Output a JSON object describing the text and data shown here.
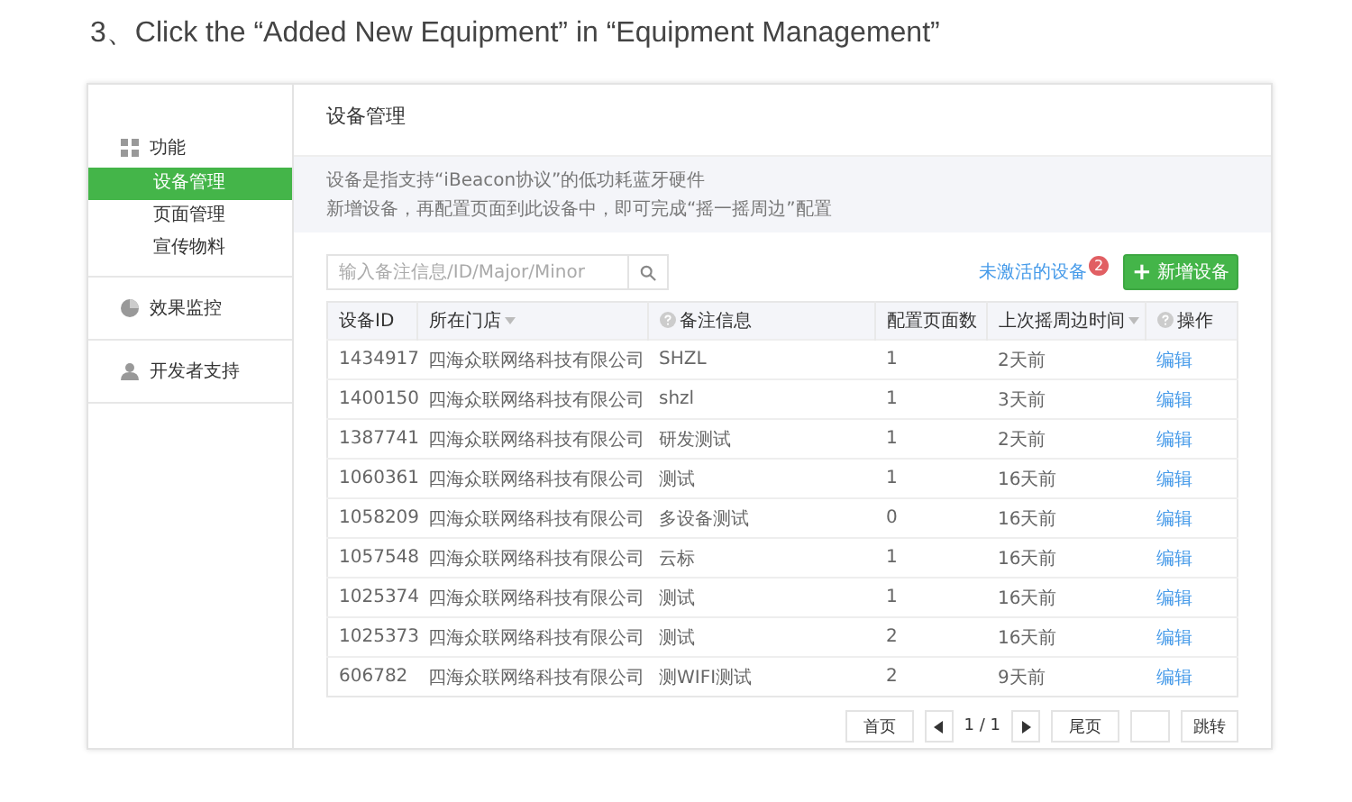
{
  "instruction": "3、Click the “Added New Equipment” in “Equipment Management”",
  "sidebar": [
    {
      "label": "功能",
      "children": [
        {
          "label": "设备管理",
          "selected": true
        },
        {
          "label": "页面管理",
          "selected": false
        },
        {
          "label": "宣传物料",
          "selected": false
        }
      ]
    },
    {
      "label": "效果监控"
    },
    {
      "label": "开发者支持"
    }
  ],
  "page_title": "设备管理",
  "info_lines": [
    "设备是指支持“iBeacon协议”的低功耗蓝牙硬件",
    "新增设备，再配置页面到此设备中，即可完成“摇一摇周边”配置"
  ],
  "search": {
    "placeholder": "输入备注信息/ID/Major/Minor"
  },
  "inactive_link": {
    "label": "未激活的设备",
    "badge": "2"
  },
  "add_button": {
    "icon": "+",
    "label": "新增设备"
  },
  "table": {
    "columns": [
      {
        "label": "设备ID",
        "help": false,
        "sortable": false
      },
      {
        "label": "所在门店",
        "help": false,
        "sortable": true
      },
      {
        "label": "备注信息",
        "help": true,
        "sortable": false
      },
      {
        "label": "配置页面数",
        "help": false,
        "sortable": false
      },
      {
        "label": "上次摇周边时间",
        "help": false,
        "sortable": true
      },
      {
        "label": "操作",
        "help": true,
        "sortable": false
      }
    ],
    "rows": [
      [
        "1434917",
        "四海众联网络科技有限公司",
        "SHZL",
        "1",
        "2天前",
        "编辑"
      ],
      [
        "1400150",
        "四海众联网络科技有限公司",
        "shzl",
        "1",
        "3天前",
        "编辑"
      ],
      [
        "1387741",
        "四海众联网络科技有限公司",
        "研发测试",
        "1",
        "2天前",
        "编辑"
      ],
      [
        "1060361",
        "四海众联网络科技有限公司",
        "测试",
        "1",
        "16天前",
        "编辑"
      ],
      [
        "1058209",
        "四海众联网络科技有限公司",
        "多设备测试",
        "0",
        "16天前",
        "编辑"
      ],
      [
        "1057548",
        "四海众联网络科技有限公司",
        "云标",
        "1",
        "16天前",
        "编辑"
      ],
      [
        "1025374",
        "四海众联网络科技有限公司",
        "测试",
        "1",
        "16天前",
        "编辑"
      ],
      [
        "1025373",
        "四海众联网络科技有限公司",
        "测试",
        "2",
        "16天前",
        "编辑"
      ],
      [
        "606782",
        "四海众联网络科技有限公司",
        "测WIFI测试",
        "2",
        "9天前",
        "编辑"
      ]
    ]
  },
  "pagination": {
    "first": "首页",
    "page": "1 / 1",
    "last": "尾页",
    "jump": "跳转"
  }
}
